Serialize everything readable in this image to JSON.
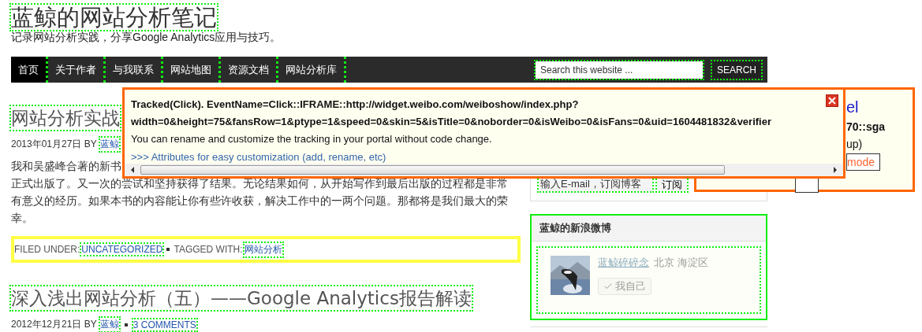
{
  "site": {
    "title": "蓝鲸的网站分析笔记",
    "tagline": "记录网站分析实践，分享Google Analytics应用与技巧。"
  },
  "nav": {
    "items": [
      {
        "label": "首页",
        "selected": true
      },
      {
        "label": "关于作者",
        "selected": false
      },
      {
        "label": "与我联系",
        "selected": false
      },
      {
        "label": "网站地图",
        "selected": false
      },
      {
        "label": "资源文档",
        "selected": false
      },
      {
        "label": "网站分析库",
        "selected": false
      }
    ],
    "search": {
      "placeholder": "Search this website ..."
    },
    "search_button": "SEARCH"
  },
  "posts": [
    {
      "title": "网站分析实战",
      "date_by": "2013年01月27日 BY",
      "author": "蓝鲸",
      "body_first": "我和吴盛峰合著的新书",
      "body_rest": "正式出版了。又一次的尝试和坚持获得了结果。无论结果如何，从开始写作到最后出版的过程都是非常有意义的经历。如果本书的内容能让你有些许收获，解决工作中的一两个问题。那都将是我们最大的荣幸。",
      "filed_label": "FILED UNDER:",
      "category": "UNCATEGORIZED",
      "tagged_label": "TAGGED WITH:",
      "tag": "网站分析"
    },
    {
      "title": "深入浅出网站分析（五）——Google Analytics报告解读",
      "date_by": "2012年12月21日 BY",
      "author": "蓝鲸",
      "comments": "3 COMMENTS"
    }
  ],
  "sidebar": {
    "subscribe": {
      "value": "输入E-mail，订阅博客",
      "button": "订阅"
    },
    "weibo": {
      "title": "蓝鲸的新浪微博",
      "name": "蓝鲸碎碎念",
      "location": "北京 海淀区",
      "button": "我自己"
    }
  },
  "panel": {
    "title": "el",
    "line1": "70::sga",
    "line2": "up)",
    "mode_button": "mode"
  },
  "popup": {
    "line1": "Tracked(Click). EventName=Click::IFRAME::http://widget.weibo.com/weiboshow/index.php?",
    "line2": "width=0&height=75&fansRow=1&ptype=1&speed=0&skin=5&isTitle=0&noborder=0&isWeibo=0&isFans=0&uid=1604481832&verifier",
    "line3": "You can rename and customize the tracking in your portal without code change.",
    "link": ">>> Attributes for easy customization (add, rename, etc)"
  }
}
